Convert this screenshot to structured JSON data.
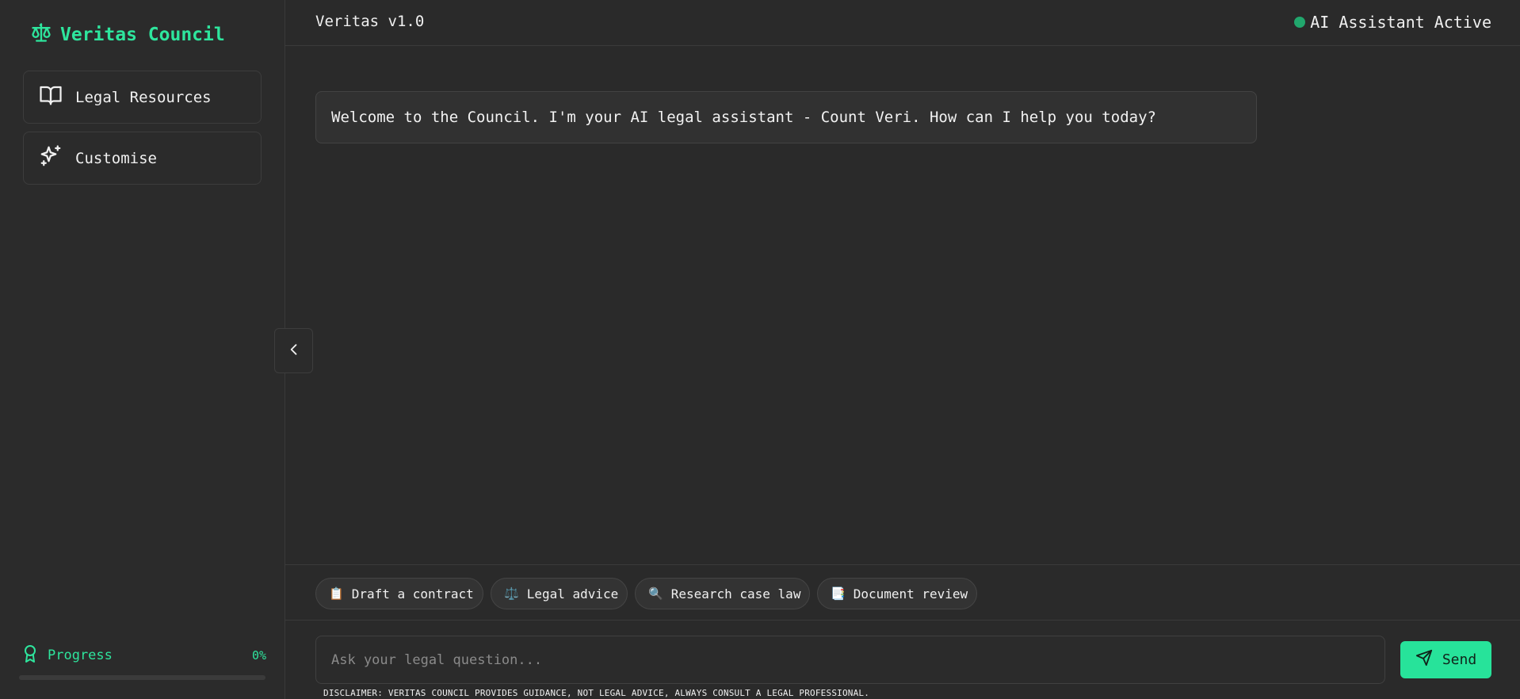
{
  "sidebar": {
    "brand": "Veritas Council",
    "items": [
      {
        "label": "Legal Resources",
        "icon": "book-open-icon"
      },
      {
        "label": "Customise",
        "icon": "sparkles-icon"
      }
    ],
    "progress": {
      "label": "Progress",
      "value_text": "0%",
      "value": 0
    }
  },
  "header": {
    "version": "Veritas v1.0",
    "status": "AI Assistant Active"
  },
  "chat": {
    "welcome": "Welcome to the Council. I'm your AI legal assistant - Count Veri. How can I help you today?"
  },
  "quick_actions": [
    {
      "icon": "📋",
      "label": "Draft a contract"
    },
    {
      "icon": "⚖️",
      "label": "Legal advice"
    },
    {
      "icon": "🔍",
      "label": "Research case law"
    },
    {
      "icon": "📑",
      "label": "Document review"
    }
  ],
  "composer": {
    "placeholder": "Ask your legal question...",
    "value": "",
    "send_label": "Send"
  },
  "disclaimer": "DISCLAIMER: VERITAS COUNCIL PROVIDES GUIDANCE, NOT LEGAL ADVICE, ALWAYS CONSULT A LEGAL PROFESSIONAL.",
  "colors": {
    "accent": "#2ee59d",
    "background": "#2a2a2a",
    "status_dot": "#21a76d"
  }
}
